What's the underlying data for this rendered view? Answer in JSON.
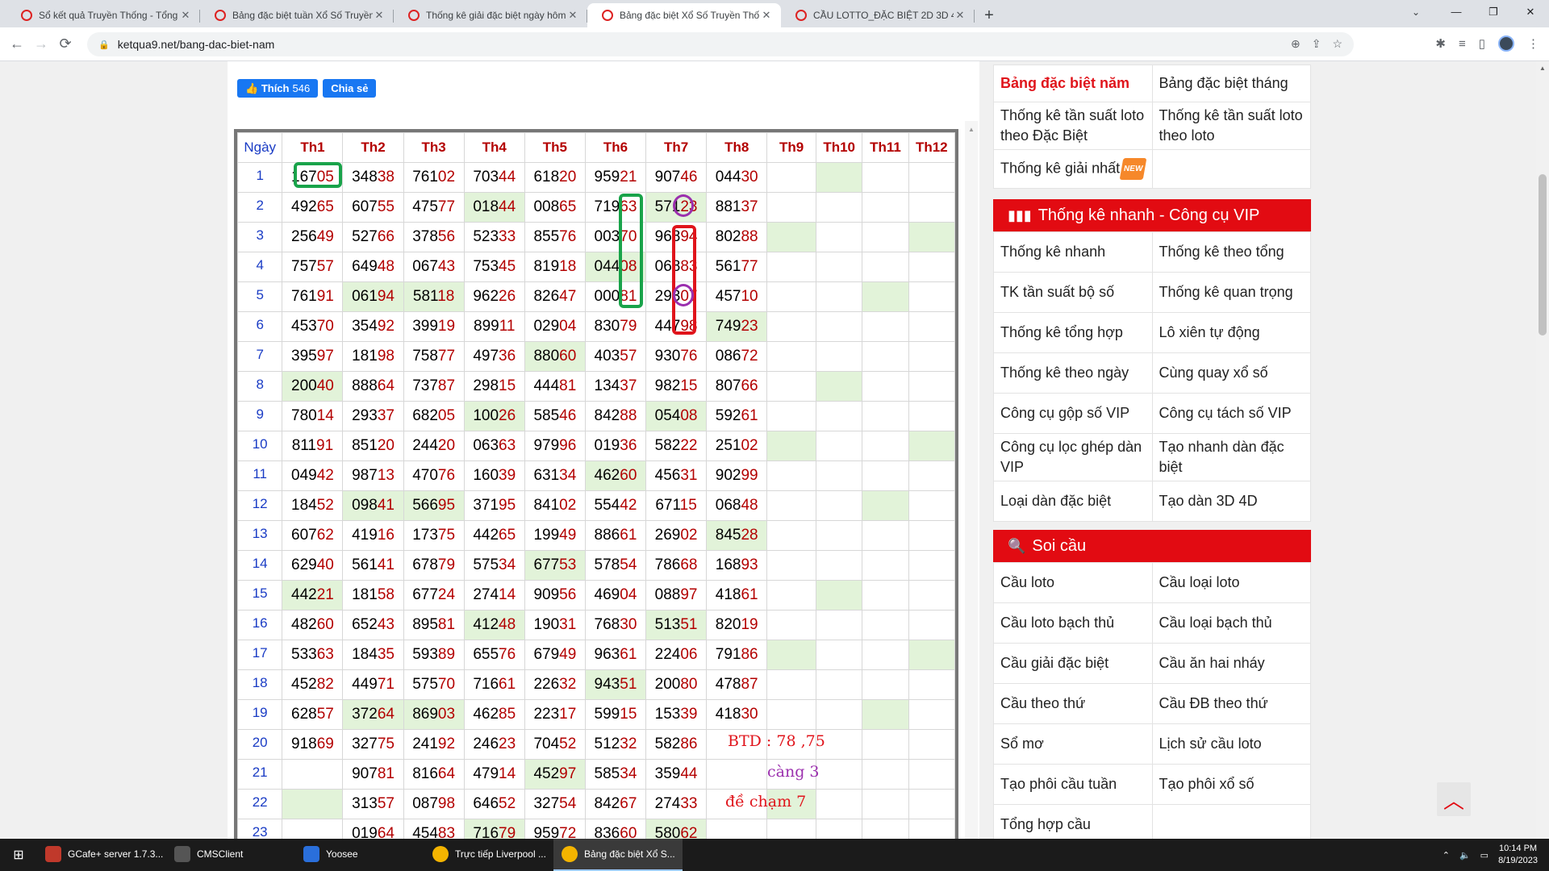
{
  "browser": {
    "tabs": [
      {
        "title": "Sổ kết quả Truyền Thống - Tổng",
        "active": false
      },
      {
        "title": "Bảng đặc biệt tuần Xổ Số Truyền",
        "active": false
      },
      {
        "title": "Thống kê giải đặc biệt ngày hôm",
        "active": false
      },
      {
        "title": "Bảng đặc biệt Xổ Số Truyền Thốn",
        "active": true
      },
      {
        "title": "CẦU LOTTO_ĐẶC BIỆT 2D 3D 4D",
        "active": false
      }
    ],
    "url": "ketqua9.net/bang-dac-biet-nam",
    "window_controls": [
      "—",
      "❐",
      "✕"
    ]
  },
  "social": {
    "like_label": "Thích",
    "like_count": "546",
    "share_label": "Chia sẻ"
  },
  "table": {
    "day_header": "Ngày",
    "headers": [
      "Th1",
      "Th2",
      "Th3",
      "Th4",
      "Th5",
      "Th6",
      "Th7",
      "Th8",
      "Th9",
      "Th10",
      "Th11",
      "Th12"
    ],
    "rows": [
      [
        "1",
        "16705",
        "34838",
        "76102",
        "70344",
        "61820",
        "95921",
        "90746",
        "04430",
        "",
        "",
        "",
        ""
      ],
      [
        "2",
        "49265",
        "60755",
        "47577",
        "01844",
        "00865",
        "71963",
        "57123",
        "88137",
        "",
        "",
        "",
        ""
      ],
      [
        "3",
        "25649",
        "52766",
        "37856",
        "52333",
        "85576",
        "00370",
        "96894",
        "80288",
        "",
        "",
        "",
        ""
      ],
      [
        "4",
        "75757",
        "64948",
        "06743",
        "75345",
        "81918",
        "04408",
        "06883",
        "56177",
        "",
        "",
        "",
        ""
      ],
      [
        "5",
        "76191",
        "06194",
        "58118",
        "96226",
        "82647",
        "00081",
        "29307",
        "45710",
        "",
        "",
        "",
        ""
      ],
      [
        "6",
        "45370",
        "35492",
        "39919",
        "89911",
        "02904",
        "83079",
        "44798",
        "74923",
        "",
        "",
        "",
        ""
      ],
      [
        "7",
        "39597",
        "18198",
        "75877",
        "49736",
        "88060",
        "40357",
        "93076",
        "08672",
        "",
        "",
        "",
        ""
      ],
      [
        "8",
        "20040",
        "88864",
        "73787",
        "29815",
        "44481",
        "13437",
        "98215",
        "80766",
        "",
        "",
        "",
        ""
      ],
      [
        "9",
        "78014",
        "29337",
        "68205",
        "10026",
        "58546",
        "84288",
        "05408",
        "59261",
        "",
        "",
        "",
        ""
      ],
      [
        "10",
        "81191",
        "85120",
        "24420",
        "06363",
        "97996",
        "01936",
        "58222",
        "25102",
        "",
        "",
        "",
        ""
      ],
      [
        "11",
        "04942",
        "98713",
        "47076",
        "16039",
        "63134",
        "46260",
        "45631",
        "90299",
        "",
        "",
        "",
        ""
      ],
      [
        "12",
        "18452",
        "09841",
        "56695",
        "37195",
        "84102",
        "55442",
        "67115",
        "06848",
        "",
        "",
        "",
        ""
      ],
      [
        "13",
        "60762",
        "41916",
        "17375",
        "44265",
        "19949",
        "88661",
        "26902",
        "84528",
        "",
        "",
        "",
        ""
      ],
      [
        "14",
        "62940",
        "56141",
        "67879",
        "57534",
        "67753",
        "57854",
        "78668",
        "16893",
        "",
        "",
        "",
        ""
      ],
      [
        "15",
        "44221",
        "18158",
        "67724",
        "27414",
        "90956",
        "46904",
        "08897",
        "41861",
        "",
        "",
        "",
        ""
      ],
      [
        "16",
        "48260",
        "65243",
        "89581",
        "41248",
        "19031",
        "76830",
        "51351",
        "82019",
        "",
        "",
        "",
        ""
      ],
      [
        "17",
        "53363",
        "18435",
        "59389",
        "65576",
        "67949",
        "96361",
        "22406",
        "79186",
        "",
        "",
        "",
        ""
      ],
      [
        "18",
        "45282",
        "44971",
        "57570",
        "71661",
        "22632",
        "94351",
        "20080",
        "47887",
        "",
        "",
        "",
        ""
      ],
      [
        "19",
        "62857",
        "37264",
        "86903",
        "46285",
        "22317",
        "59915",
        "15339",
        "41830",
        "",
        "",
        "",
        ""
      ],
      [
        "20",
        "91869",
        "32775",
        "24192",
        "24623",
        "70452",
        "51232",
        "58286",
        "",
        "",
        "",
        "",
        ""
      ],
      [
        "21",
        "",
        "90781",
        "81664",
        "47914",
        "45297",
        "58534",
        "35944",
        "",
        "",
        "",
        "",
        ""
      ],
      [
        "22",
        "",
        "31357",
        "08798",
        "64652",
        "32754",
        "84267",
        "27433",
        "",
        "",
        "",
        "",
        ""
      ],
      [
        "23",
        "",
        "01964",
        "45483",
        "71679",
        "95972",
        "83660",
        "58062",
        "",
        "",
        "",
        "",
        ""
      ]
    ],
    "green_cells": [
      [
        1,
        10
      ],
      [
        2,
        4
      ],
      [
        2,
        7
      ],
      [
        3,
        9
      ],
      [
        3,
        12
      ],
      [
        4,
        6
      ],
      [
        5,
        2
      ],
      [
        5,
        3
      ],
      [
        5,
        11
      ],
      [
        6,
        8
      ],
      [
        7,
        5
      ],
      [
        8,
        1
      ],
      [
        8,
        10
      ],
      [
        9,
        4
      ],
      [
        9,
        7
      ],
      [
        10,
        9
      ],
      [
        10,
        12
      ],
      [
        11,
        6
      ],
      [
        12,
        2
      ],
      [
        12,
        3
      ],
      [
        12,
        11
      ],
      [
        13,
        8
      ],
      [
        14,
        5
      ],
      [
        15,
        1
      ],
      [
        15,
        10
      ],
      [
        16,
        4
      ],
      [
        16,
        7
      ],
      [
        17,
        9
      ],
      [
        17,
        12
      ],
      [
        18,
        6
      ],
      [
        19,
        2
      ],
      [
        19,
        3
      ],
      [
        19,
        11
      ],
      [
        21,
        5
      ],
      [
        22,
        1
      ],
      [
        22,
        9
      ],
      [
        23,
        4
      ],
      [
        23,
        7
      ]
    ],
    "notes": {
      "btd": "BTD : 78 ,75",
      "cang": "càng 3",
      "de": "đề chạm 7"
    },
    "note_colors": {
      "btd": "#e0141b",
      "cang": "#9b2fae",
      "de": "#e0141b"
    }
  },
  "sidebar": {
    "links_top": [
      [
        "Bảng đặc biệt năm",
        "Bảng đặc biệt tháng"
      ],
      [
        "Thống kê tần suất loto theo Đặc Biệt",
        "Thống kê tần suất loto theo loto"
      ],
      [
        "Thống kê giải nhất",
        ""
      ]
    ],
    "new_badge": "NEW",
    "vip_title": "Thống kê nhanh - Công cụ VIP",
    "vip_links": [
      [
        "Thống kê nhanh",
        "Thống kê theo tổng"
      ],
      [
        "TK tần suất bộ số",
        "Thống kê quan trọng"
      ],
      [
        "Thống kê tổng hợp",
        "Lô xiên tự động"
      ],
      [
        "Thống kê theo ngày",
        "Cùng quay xổ số"
      ],
      [
        "Công cụ gộp số VIP",
        "Công cụ tách số VIP"
      ],
      [
        "Công cụ lọc ghép dàn VIP",
        "Tạo nhanh dàn đặc biệt"
      ],
      [
        "Loại dàn đặc biệt",
        "Tạo dàn 3D 4D"
      ]
    ],
    "soicau_title": "Soi cầu",
    "soicau_links": [
      [
        "Cầu loto",
        "Cầu loại loto"
      ],
      [
        "Cầu loto bạch thủ",
        "Cầu loại bạch thủ"
      ],
      [
        "Cầu giải đặc biệt",
        "Cầu ăn hai nháy"
      ],
      [
        "Cầu theo thứ",
        "Cầu ĐB theo thứ"
      ],
      [
        "Sổ mơ",
        "Lịch sử cầu loto"
      ],
      [
        "Tạo phôi cầu tuần",
        "Tạo phôi xổ số"
      ],
      [
        "Tổng hợp cầu",
        ""
      ]
    ],
    "accent_color": "#e20b12"
  },
  "taskbar": {
    "items": [
      {
        "label": "GCafe+ server 1.7.3...",
        "icon": "gcafe-icon",
        "active": false
      },
      {
        "label": "CMSClient",
        "icon": "cms-icon",
        "active": false
      },
      {
        "label": "Yoosee",
        "icon": "yoosee-icon",
        "active": false
      },
      {
        "label": "Trực tiếp Liverpool ...",
        "icon": "chrome-icon",
        "active": false
      },
      {
        "label": "Bảng đặc biệt Xổ S...",
        "icon": "chrome-icon",
        "active": true
      }
    ],
    "time": "10:14 PM",
    "date": "8/19/2023"
  }
}
